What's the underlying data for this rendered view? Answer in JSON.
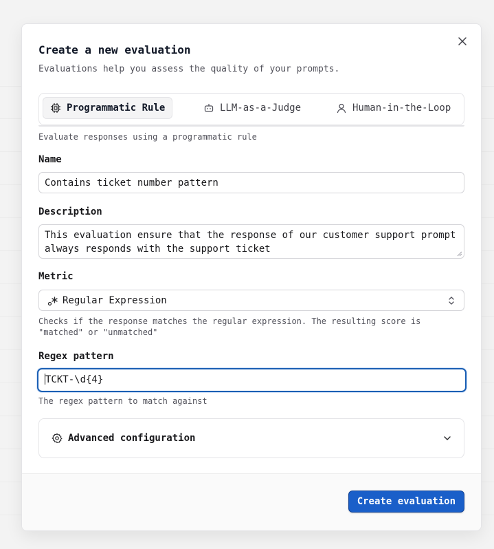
{
  "modal": {
    "title": "Create a new evaluation",
    "subtitle": "Evaluations help you assess the quality of your prompts."
  },
  "tabs": [
    {
      "label": "Programmatic Rule",
      "icon": "cpu-icon",
      "active": true
    },
    {
      "label": "LLM-as-a-Judge",
      "icon": "bot-icon",
      "active": false
    },
    {
      "label": "Human-in-the-Loop",
      "icon": "user-icon",
      "active": false
    }
  ],
  "tab_hint": "Evaluate responses using a programmatic rule",
  "name": {
    "label": "Name",
    "value": "Contains ticket number pattern"
  },
  "description": {
    "label": "Description",
    "value": "This evaluation ensure that the response of our customer support prompt always responds with the support ticket"
  },
  "metric": {
    "label": "Metric",
    "icon": "regex-icon",
    "value": "Regular Expression",
    "hint_line1": "Checks if the response matches the regular expression. The resulting score is",
    "hint_line2": "\"matched\" or \"unmatched\""
  },
  "regex": {
    "label": "Regex pattern",
    "value": "TCKT-\\d{4}",
    "hint": "The regex pattern to match against"
  },
  "advanced": {
    "label": "Advanced configuration"
  },
  "footer": {
    "submit_label": "Create evaluation"
  },
  "colors": {
    "accent": "#1a5fc9",
    "focus_ring": "#1a5fb4"
  }
}
